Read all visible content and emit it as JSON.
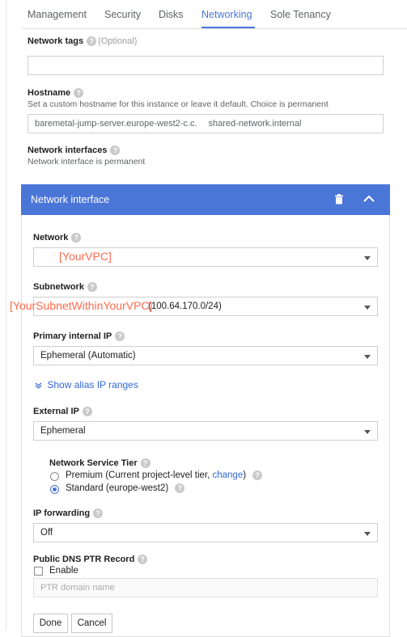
{
  "tabs": [
    "Management",
    "Security",
    "Disks",
    "Networking",
    "Sole Tenancy"
  ],
  "active_tab": "Networking",
  "network_tags": {
    "label": "Network tags",
    "optional": "(Optional)",
    "value": ""
  },
  "hostname": {
    "label": "Hostname",
    "description": "Set a custom hostname for this instance or leave it default. Choice is permanent",
    "value_part1": "baremetal-jump-server.europe-west2-c.c.",
    "value_part2": "shared-network.internal"
  },
  "network_interfaces": {
    "label": "Network interfaces",
    "description": "Network interface is permanent"
  },
  "panel": {
    "title": "Network interface",
    "network": {
      "label": "Network",
      "value": ""
    },
    "network_annotation": "[YourVPC]",
    "subnetwork": {
      "label": "Subnetwork",
      "value": "(100.64.170.0/24)"
    },
    "subnetwork_annotation": "[YourSubnetWithinYourVPC]",
    "primary_ip": {
      "label": "Primary internal IP",
      "value": "Ephemeral (Automatic)"
    },
    "alias_link": "Show alias IP ranges",
    "external_ip": {
      "label": "External IP",
      "value": "Ephemeral"
    },
    "tier": {
      "label": "Network Service Tier",
      "premium_text": "Premium (Current project-level tier, ",
      "premium_link": "change",
      "premium_close": ")",
      "standard_text": "Standard (europe-west2)",
      "selected": "standard"
    },
    "ip_forwarding": {
      "label": "IP forwarding",
      "value": "Off"
    },
    "dns_ptr": {
      "label": "Public DNS PTR Record",
      "enable_label": "Enable",
      "enabled": false,
      "placeholder": "PTR domain name"
    },
    "buttons": {
      "done": "Done",
      "cancel": "Cancel"
    }
  },
  "colors": {
    "accent": "#4a76d8",
    "annotation": "#ff6a4d",
    "link": "#3367d6"
  }
}
